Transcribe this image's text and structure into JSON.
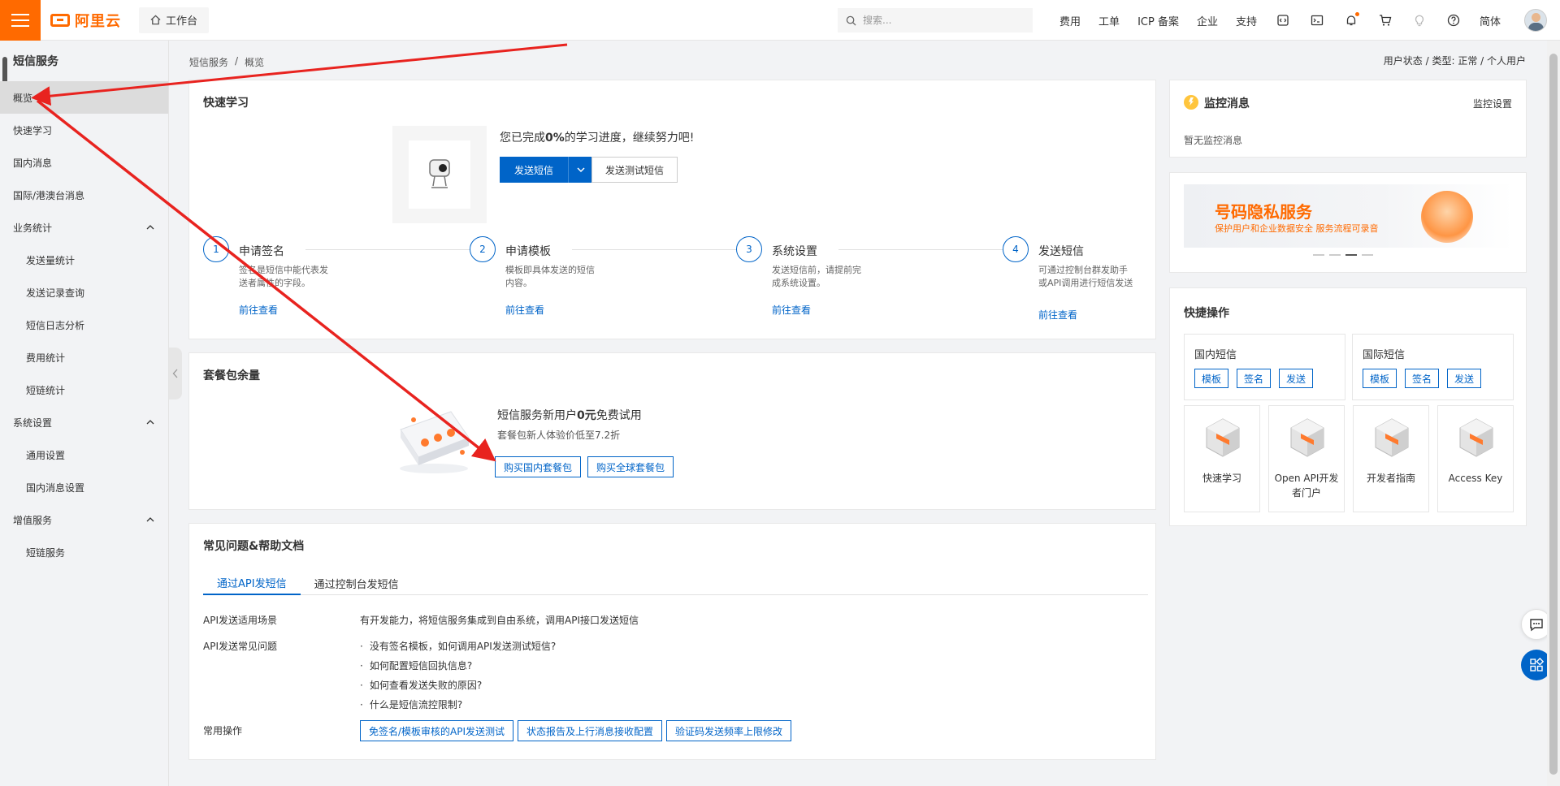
{
  "topbar": {
    "logo": "阿里云",
    "workbench": "工作台",
    "search_placeholder": "搜索...",
    "links": [
      "费用",
      "工单",
      "ICP 备案",
      "企业",
      "支持"
    ],
    "lang": "简体"
  },
  "sidebar": {
    "title": "短信服务",
    "items": [
      {
        "label": "概览"
      },
      {
        "label": "快速学习"
      },
      {
        "label": "国内消息"
      },
      {
        "label": "国际/港澳台消息"
      },
      {
        "label": "业务统计"
      },
      {
        "label": "发送量统计"
      },
      {
        "label": "发送记录查询"
      },
      {
        "label": "短信日志分析"
      },
      {
        "label": "费用统计"
      },
      {
        "label": "短链统计"
      },
      {
        "label": "系统设置"
      },
      {
        "label": "通用设置"
      },
      {
        "label": "国内消息设置"
      },
      {
        "label": "增值服务"
      },
      {
        "label": "短链服务"
      }
    ]
  },
  "breadcrumb": {
    "root": "短信服务",
    "sep": "/",
    "current": "概览"
  },
  "user_status": "用户状态 / 类型:  正常 / 个人用户",
  "quick_learn": {
    "title": "快速学习",
    "progress_prefix": "您已完成",
    "progress_value": "0%",
    "progress_suffix": "的学习进度，继续努力吧!",
    "send_button": "发送短信",
    "test_button": "发送测试短信",
    "steps": [
      {
        "num": "1",
        "name": "申请签名",
        "desc": "签名是短信中能代表发送者属性的字段。",
        "link": "前往查看"
      },
      {
        "num": "2",
        "name": "申请模板",
        "desc": "模板即具体发送的短信内容。",
        "link": "前往查看"
      },
      {
        "num": "3",
        "name": "系统设置",
        "desc": "发送短信前，请提前完成系统设置。",
        "link": "前往查看"
      },
      {
        "num": "4",
        "name": "发送短信",
        "desc": "可通过控制台群发助手或API调用进行短信发送",
        "link": "前往查看"
      }
    ]
  },
  "package": {
    "title": "套餐包余量",
    "headline_prefix": "短信服务新用户",
    "headline_value": "0元",
    "headline_suffix": "免费试用",
    "subline": "套餐包新人体验价低至7.2折",
    "buy_domestic": "购买国内套餐包",
    "buy_global": "购买全球套餐包"
  },
  "faq": {
    "title": "常见问题&帮助文档",
    "tabs": [
      "通过API发短信",
      "通过控制台发短信"
    ],
    "scene_label": "API发送适用场景",
    "scene_text": "有开发能力，将短信服务集成到自由系统，调用API接口发送短信",
    "questions_label": "API发送常见问题",
    "questions": [
      "没有签名模板，如何调用API发送测试短信?",
      "如何配置短信回执信息?",
      "如何查看发送失败的原因?",
      "什么是短信流控限制?"
    ],
    "ops_label": "常用操作",
    "ops": [
      "免签名/模板审核的API发送测试",
      "状态报告及上行消息接收配置",
      "验证码发送频率上限修改"
    ]
  },
  "monitor": {
    "title": "监控消息",
    "setting": "监控设置",
    "empty": "暂无监控消息"
  },
  "banner": {
    "title": "号码隐私服务",
    "subtitle": "保护用户和企业数据安全 服务流程可录音"
  },
  "shortcuts": {
    "title": "快捷操作",
    "domestic": {
      "title": "国内短信",
      "buttons": [
        "模板",
        "签名",
        "发送"
      ]
    },
    "international": {
      "title": "国际短信",
      "buttons": [
        "模板",
        "签名",
        "发送"
      ]
    },
    "tiles": [
      {
        "label": "快速学习"
      },
      {
        "label": "Open API开发者门户"
      },
      {
        "label": "开发者指南"
      },
      {
        "label": "Access Key"
      }
    ]
  },
  "colors": {
    "brand": "#ff6a00",
    "primary": "#0064c8",
    "annotation": "#e8231f"
  }
}
